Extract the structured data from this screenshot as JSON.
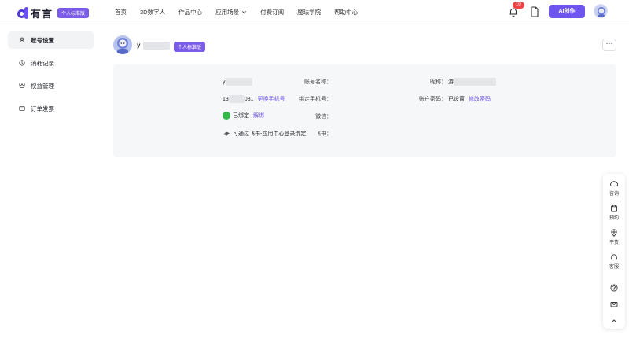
{
  "header": {
    "logo_text": "有言",
    "plan_badge": "个人标准版",
    "nav": [
      {
        "label": "首页"
      },
      {
        "label": "3D数字人"
      },
      {
        "label": "作品中心"
      },
      {
        "label": "应用场景",
        "has_dropdown": true
      },
      {
        "label": "付费订阅"
      },
      {
        "label": "魔珐学院"
      },
      {
        "label": "帮助中心"
      }
    ],
    "notification_count": "10",
    "ai_button": "AI创作"
  },
  "sidebar": {
    "items": [
      {
        "label": "账号设置",
        "icon": "user-icon",
        "active": true
      },
      {
        "label": "消耗记录",
        "icon": "clock-icon",
        "active": false
      },
      {
        "label": "权益管理",
        "icon": "crown-icon",
        "active": false
      },
      {
        "label": "订单发票",
        "icon": "card-icon",
        "active": false
      }
    ]
  },
  "profile": {
    "name_visible": "y",
    "plan_badge": "个人标准版",
    "more_label": "···"
  },
  "account": {
    "account_name_label": "账号名称：",
    "account_name_visible": "y",
    "nickname_label": "昵称：",
    "nickname_visible": "游",
    "phone_label": "绑定手机号：",
    "phone_prefix": "13",
    "phone_suffix": "031",
    "change_phone": "更换手机号",
    "password_label": "账户密码：",
    "password_status": "已设置",
    "change_password": "修改密码",
    "wechat_label": "微信：",
    "wechat_status": "已绑定",
    "unbind": "解绑",
    "lark_label": "飞书：",
    "lark_hint": "可通过飞书-应用中心登录绑定"
  },
  "float_bar": {
    "items": [
      {
        "label": "咨询",
        "icon": "chat-cloud-icon"
      },
      {
        "label": "预约",
        "icon": "calendar-icon"
      },
      {
        "label": "干货",
        "icon": "location-pin-icon"
      },
      {
        "label": "客服",
        "icon": "headset-icon"
      }
    ],
    "help_icon": "question-icon",
    "mail_icon": "mail-icon",
    "top_icon": "chevron-up-icon"
  },
  "colors": {
    "brand": "#6e55f0",
    "badge": "#7b5ce8",
    "link": "#6a55e8",
    "notification": "#f04444",
    "wechat": "#31b94a",
    "card_bg": "#f6f7f9"
  }
}
